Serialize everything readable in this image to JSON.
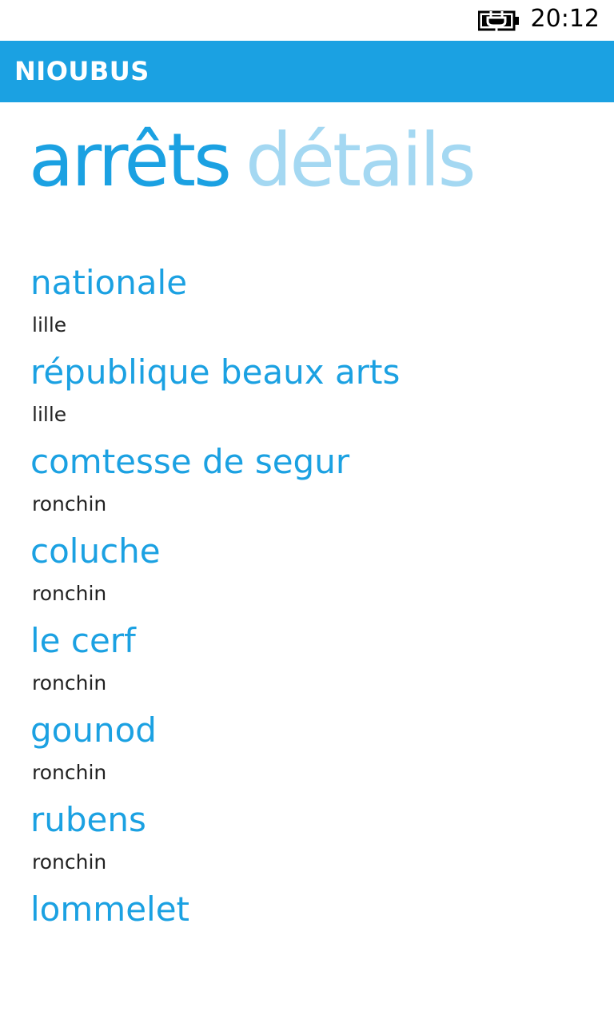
{
  "status_bar": {
    "time": "20:12",
    "battery_icon": "battery-charging-icon"
  },
  "app": {
    "title": "NIOUBUS"
  },
  "pivot": {
    "tabs": [
      {
        "label": "arrêts",
        "active": true
      },
      {
        "label": "détails",
        "active": false
      }
    ]
  },
  "stops": [
    {
      "name": "nationale",
      "city": "lille"
    },
    {
      "name": "république beaux arts",
      "city": "lille"
    },
    {
      "name": "comtesse de segur",
      "city": "ronchin"
    },
    {
      "name": "coluche",
      "city": "ronchin"
    },
    {
      "name": "le cerf",
      "city": "ronchin"
    },
    {
      "name": "gounod",
      "city": "ronchin"
    },
    {
      "name": "rubens",
      "city": "ronchin"
    },
    {
      "name": "lommelet",
      "city": ""
    }
  ],
  "colors": {
    "accent": "#1ba1e2",
    "inactive_tab": "#a4d8f2",
    "text_secondary": "#222222"
  }
}
